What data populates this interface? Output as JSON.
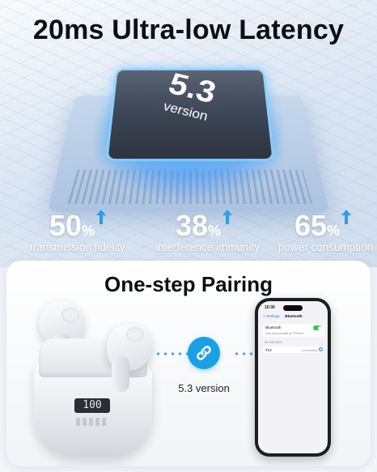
{
  "headline": "20ms Ultra-low Latency",
  "chip": {
    "number": "5.3",
    "label": "version"
  },
  "stats": [
    {
      "value": "50",
      "unit": "%",
      "caption": "transmission fidelity"
    },
    {
      "value": "38",
      "unit": "%",
      "caption": "interference immunity"
    },
    {
      "value": "65",
      "unit": "%",
      "caption": "power consumption"
    }
  ],
  "pairing": {
    "title": "One-step Pairing",
    "connection_label": "5.3 version",
    "case_display": "100"
  },
  "phone": {
    "time": "10:30",
    "back_label": "< Settings",
    "screen_title": "Bluetooth",
    "bluetooth_label": "Bluetooth",
    "discoverable_text": "Now discoverable as \"iPhone\".",
    "section_label": "MY DEVICES",
    "device_name": "T13",
    "device_status": "Connected",
    "info_glyph": "i"
  },
  "colors": {
    "accent_blue": "#1aa0e6",
    "arrow_blue": "#2f9de8",
    "toggle_green": "#34c759"
  },
  "icons": [
    "arrow-up-icon",
    "chain-link-icon",
    "info-icon"
  ]
}
